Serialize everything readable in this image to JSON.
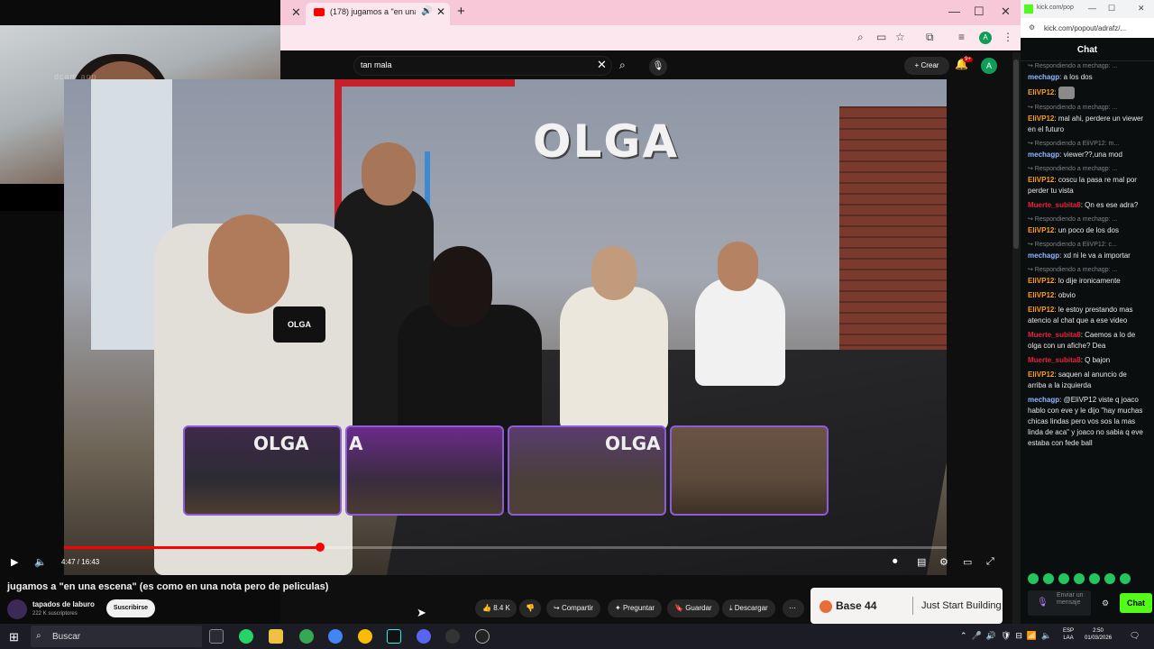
{
  "colors": {
    "youtube_red": "#ff0000",
    "kick_green": "#53fc18",
    "chrome_tab_pink": "#f7c9d8",
    "thumb_border": "#8d5dd9",
    "username_orange": "#ff9f1a",
    "username_blue": "#8fb8ff",
    "username_red": "#e5243b"
  },
  "webcam": {
    "watermark": "dcam app"
  },
  "browser": {
    "tab_title": "(178) jugamos a \"en una esc",
    "new_tab_icon": "plus-icon",
    "window_controls": [
      "—",
      "☐",
      "✕"
    ]
  },
  "youtube": {
    "search_query": "tan mala",
    "create_label": "Crear",
    "notification_count": "9+",
    "avatar_letter": "A",
    "video": {
      "sign_text": "OLGA",
      "mic_flag_text": "OLGA",
      "thumb_logos": [
        "OLGA",
        "A",
        "OLGA",
        ""
      ],
      "time_display": "4:47 / 16:43",
      "progress_fraction": 0.29
    },
    "title": "jugamos a \"en una escena\" (es como en una nota pero de peliculas)",
    "channel": {
      "name": "tapados de laburo",
      "subscribers": "222 K suscriptores",
      "subscribe_label": "Suscribirse"
    },
    "actions": {
      "likes": "8.4 K",
      "share": "Compartir",
      "ask": "Preguntar",
      "save": "Guardar",
      "download": "Descargar"
    },
    "ad": {
      "brand": "Base 44",
      "tagline": "Just Start Building"
    }
  },
  "kick": {
    "tab_title": "kick.com/pop",
    "url": "kick.com/popout/adrafz/...",
    "chat_title": "Chat",
    "messages": [
      {
        "reply": "Respondiendo a mechagp: ...",
        "user": "mechagp",
        "color": "#8fb8ff",
        "text": "a los dos"
      },
      {
        "reply": "",
        "user": "EliVP12",
        "color": "#ff9f1a",
        "text": ""
      },
      {
        "reply": "Respondiendo a mechagp: ...",
        "user": "EliVP12",
        "color": "#ff9f1a",
        "text": "mal ahi, perdere un viewer en el futuro"
      },
      {
        "reply": "Respondiendo a EliVP12: m...",
        "user": "mechagp",
        "color": "#8fb8ff",
        "text": "viewer??,una mod"
      },
      {
        "reply": "Respondiendo a mechagp: ...",
        "user": "EliVP12",
        "color": "#ff9f1a",
        "text": "coscu la pasa re mal por perder tu vista"
      },
      {
        "reply": "",
        "user": "Muerte_subita8",
        "color": "#e5243b",
        "text": "Qn es ese adra?"
      },
      {
        "reply": "Respondiendo a mechagp: ...",
        "user": "EliVP12",
        "color": "#ff9f1a",
        "text": "un poco de los dos"
      },
      {
        "reply": "Respondiendo a EliVP12: c...",
        "user": "mechagp",
        "color": "#8fb8ff",
        "text": "xd ni le va a importar"
      },
      {
        "reply": "Respondiendo a mechagp: ...",
        "user": "EliVP12",
        "color": "#ff9f1a",
        "text": "lo dije ironicamente"
      },
      {
        "reply": "",
        "user": "EliVP12",
        "color": "#ff9f1a",
        "text": "obvio"
      },
      {
        "reply": "",
        "user": "EliVP12",
        "color": "#ff9f1a",
        "text": "le estoy prestando mas atencio al chat que a ese video"
      },
      {
        "reply": "",
        "user": "Muerte_subita8",
        "color": "#e5243b",
        "text": "Caemos a lo de olga con un afiche? Dea"
      },
      {
        "reply": "",
        "user": "Muerte_subita8",
        "color": "#e5243b",
        "text": "Q bajon"
      },
      {
        "reply": "",
        "user": "EliVP12",
        "color": "#ff9f1a",
        "text": "saquen al anuncio de arriba a la izquierda"
      },
      {
        "reply": "",
        "user": "mechagp",
        "color": "#8fb8ff",
        "text": "@EliVP12 viste q joaco hablo con eve y le dijo \"hay muchas chicas lindas pero vos sos la mas linda de aca\" y joaco no sabia q eve estaba con fede ball"
      }
    ],
    "input_placeholder": "Enviar un mensaje",
    "send_label": "Chat"
  },
  "taskbar": {
    "search_placeholder": "Buscar",
    "lang": "ESP",
    "lang2": "LAA",
    "time": "2:50",
    "date": "01/03/2026"
  }
}
